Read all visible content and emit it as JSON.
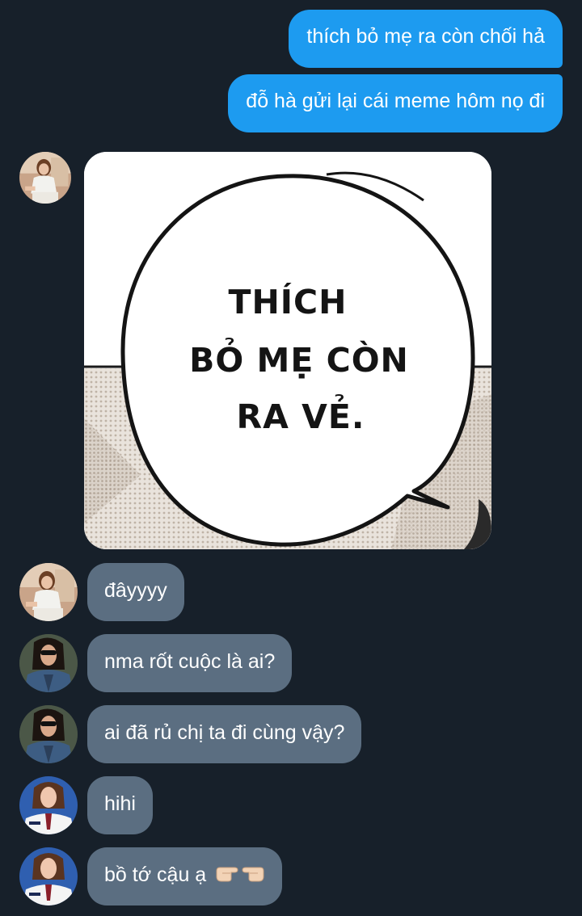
{
  "messages_out": [
    {
      "text": "thích bỏ mẹ ra còn chối hả"
    },
    {
      "text": "đỗ hà gửi lại cái meme hôm nọ đi"
    }
  ],
  "meme": {
    "line1": "THÍCH",
    "line2": "BỎ MẸ CÒN",
    "line3": "RA VẺ."
  },
  "messages_in": [
    {
      "text": "đâyyyy",
      "sender": "avatar-woman-white-outfit"
    },
    {
      "text": "nma rốt cuộc là ai?",
      "sender": "avatar-woman-sunglasses"
    },
    {
      "text": "ai đã rủ chị ta đi cùng vậy?",
      "sender": "avatar-woman-sunglasses"
    },
    {
      "text": "hihi",
      "sender": "avatar-woman-tie"
    },
    {
      "text": "bồ tớ cậu ạ",
      "sender": "avatar-woman-tie",
      "emoji": "pointing-fingers-icon"
    }
  ],
  "colors": {
    "background": "#17202a",
    "outgoing_bubble": "#1d9bf0",
    "incoming_bubble": "#5b6e81"
  }
}
